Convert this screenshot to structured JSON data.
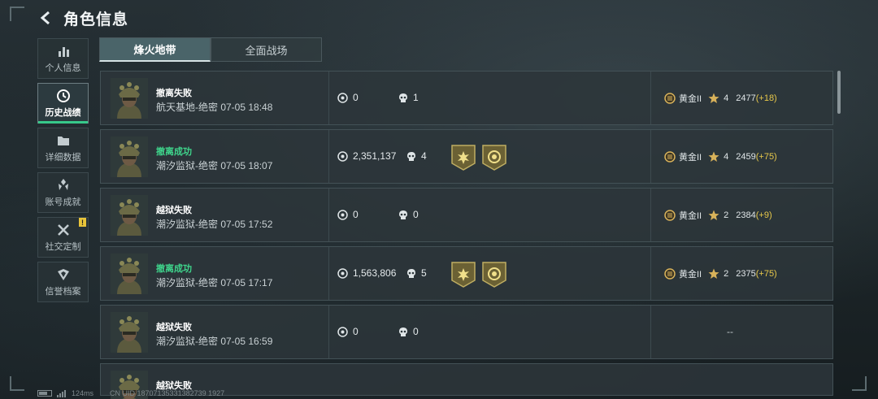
{
  "header": {
    "title": "角色信息"
  },
  "sidebar": {
    "items": [
      {
        "label": "个人信息",
        "icon": "bar-chart-icon",
        "active": false
      },
      {
        "label": "历史战绩",
        "icon": "clock-icon",
        "active": true
      },
      {
        "label": "详细数据",
        "icon": "folder-icon",
        "active": false
      },
      {
        "label": "账号成就",
        "icon": "achievement-icon",
        "active": false
      },
      {
        "label": "社交定制",
        "icon": "tools-icon",
        "active": false,
        "badge": "!"
      },
      {
        "label": "信誉档案",
        "icon": "shield-icon",
        "active": false
      }
    ]
  },
  "tabs": [
    {
      "label": "烽火地带",
      "active": true
    },
    {
      "label": "全面战场",
      "active": false
    }
  ],
  "matches": [
    {
      "result": "撤离失败",
      "success": false,
      "detail": "航天基地-绝密 07-05 18:48",
      "money": "0",
      "kills": "1",
      "medals": 0,
      "tier": "",
      "stars": "4",
      "score": "2477",
      "delta": "(+18)"
    },
    {
      "result": "撤离成功",
      "success": true,
      "detail": "潮汐监狱-绝密 07-05 18:07",
      "money": "2,351,137",
      "kills": "4",
      "medals": 2,
      "tier": "黄金II",
      "stars": "4",
      "score": "2459",
      "delta": "(+75)"
    },
    {
      "result": "越狱失败",
      "success": false,
      "detail": "潮汐监狱-绝密 07-05 17:52",
      "money": "0",
      "kills": "0",
      "medals": 0,
      "tier": "黄金II",
      "stars": "2",
      "score": "2384",
      "delta": "(+9)"
    },
    {
      "result": "撤离成功",
      "success": true,
      "detail": "潮汐监狱-绝密 07-05 17:17",
      "money": "1,563,806",
      "kills": "5",
      "medals": 2,
      "tier": "黄金II",
      "stars": "2",
      "score": "2375",
      "delta": "(+75)"
    },
    {
      "result": "越狱失败",
      "success": false,
      "detail": "潮汐监狱-绝密 07-05 16:59",
      "money": "0",
      "kills": "0",
      "medals": 0,
      "rank_placeholder": "--"
    },
    {
      "result": "越狱失败",
      "success": false,
      "detail": "",
      "money": "",
      "kills": "",
      "medals": 0,
      "partial": true
    }
  ],
  "row0_tier": "黄金II",
  "footer": {
    "ping": "124ms",
    "uid": "CN UID 18707135331382739 1927"
  },
  "colors": {
    "accent_green": "#37c98a",
    "success_text": "#3fd58c",
    "delta_gold": "#e7c84a"
  }
}
